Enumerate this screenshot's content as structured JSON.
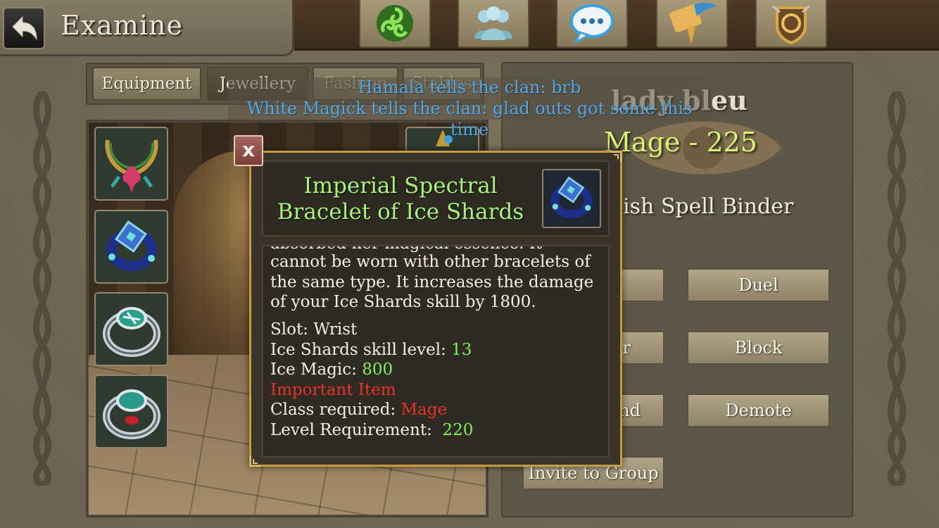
{
  "header": {
    "title": "Examine",
    "back_icon": "back-arrow-icon",
    "nav_icons": [
      {
        "name": "triskelion-icon",
        "color": "#5fbf3a"
      },
      {
        "name": "social-icon",
        "color": "#8fc8d6"
      },
      {
        "name": "chat-icon",
        "color": "#3aa0e0"
      },
      {
        "name": "quest-scroll-icon",
        "color": "#e0a53c"
      },
      {
        "name": "clan-shield-icon",
        "color": "#d9a84a"
      }
    ]
  },
  "tabs": [
    {
      "label": "Equipment",
      "active": false
    },
    {
      "label": "Jewellery",
      "active": true
    },
    {
      "label": "Fashion",
      "active": false
    },
    {
      "label": "Stables",
      "active": false
    }
  ],
  "equipment_slots": [
    {
      "icon": "necklace-icon"
    },
    {
      "icon": "bracelet-icon"
    },
    {
      "icon": "ring-icon"
    },
    {
      "icon": "ring-icon"
    }
  ],
  "chat": {
    "lines": [
      "Hamala tells the clan: brb",
      "White Magick tells the clan: glad outs got some this",
      "time"
    ]
  },
  "player": {
    "name": "lady bleu",
    "class_level": "Mage - 225",
    "rank": "ish Spell Binder"
  },
  "actions": {
    "left": [
      "",
      "r",
      "nd",
      "Invite to Group"
    ],
    "right": [
      "Duel",
      "Block",
      "Demote"
    ]
  },
  "item": {
    "title": "Imperial Spectral Bracelet of Ice Shards",
    "icon": "bracelet-icon",
    "close_label": "x",
    "description_clipped": "absorbed her magical essence. It",
    "description": "cannot be worn with other bracelets of the same type. It increases the damage of your Ice Shards skill by 1800.",
    "stats": {
      "slot_label": "Slot:",
      "slot_value": "Wrist",
      "skill_label": "Ice Shards skill level:",
      "skill_value": "13",
      "magic_label": "Ice Magic:",
      "magic_value": "800",
      "important": "Important Item",
      "class_label": "Class required:",
      "class_value": "Mage",
      "level_label": "Level Requirement:",
      "level_value": "220"
    }
  },
  "colors": {
    "item_title": "#a6f27a",
    "stat_green": "#7ff05c",
    "stat_red": "#e7322a",
    "chat_blue": "#4fa8e9",
    "class_yellow": "#d7f277",
    "tooltip_border": "#c69a3e"
  }
}
